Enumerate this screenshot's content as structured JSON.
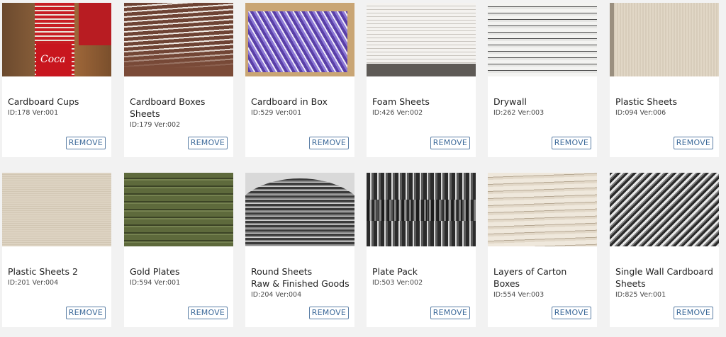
{
  "cards": [
    {
      "title": "Cardboard Cups",
      "meta": "ID:178 Ver:001",
      "button": "REMOVE",
      "thumb_icon": "coca-cola-cup-stack"
    },
    {
      "title": "Cardboard Boxes\nSheets",
      "meta": "ID:179 Ver:002",
      "button": "REMOVE",
      "thumb_icon": "brown-box-sheet-stack"
    },
    {
      "title": "Cardboard in Box",
      "meta": "ID:529 Ver:001",
      "button": "REMOVE",
      "thumb_icon": "purple-cardboard-in-box"
    },
    {
      "title": "Foam Sheets",
      "meta": "ID:426 Ver:002",
      "button": "REMOVE",
      "thumb_icon": "foam-sheet-stack"
    },
    {
      "title": "Drywall",
      "meta": "ID:262 Ver:003",
      "button": "REMOVE",
      "thumb_icon": "drywall-stack"
    },
    {
      "title": "Plastic Sheets",
      "meta": "ID:094 Ver:006",
      "button": "REMOVE",
      "thumb_icon": "plastic-sheet-surface"
    },
    {
      "title": "Plastic Sheets 2",
      "meta": "ID:201 Ver:004",
      "button": "REMOVE",
      "thumb_icon": "plastic-sheet-surface"
    },
    {
      "title": "Gold Plates",
      "meta": "ID:594 Ver:001",
      "button": "REMOVE",
      "thumb_icon": "gold-plate-stack"
    },
    {
      "title": "Round Sheets\nRaw & Finished Goods",
      "meta": "ID:204 Ver:004",
      "button": "REMOVE",
      "thumb_icon": "round-sheet-stack"
    },
    {
      "title": "Plate Pack",
      "meta": "ID:503 Ver:002",
      "button": "REMOVE",
      "thumb_icon": "plate-pack"
    },
    {
      "title": "Layers of Carton Boxes",
      "meta": "ID:554 Ver:003",
      "button": "REMOVE",
      "thumb_icon": "carton-layers"
    },
    {
      "title": "Single Wall Cardboard\nSheets",
      "meta": "ID:825 Ver:001",
      "button": "REMOVE",
      "thumb_icon": "corrugated-cardboard"
    }
  ],
  "cups_logo": "Coca",
  "colors": {
    "background": "#f2f2f2",
    "card": "#ffffff",
    "button_border": "#5b7fa6",
    "button_text": "#3d6a9a"
  }
}
